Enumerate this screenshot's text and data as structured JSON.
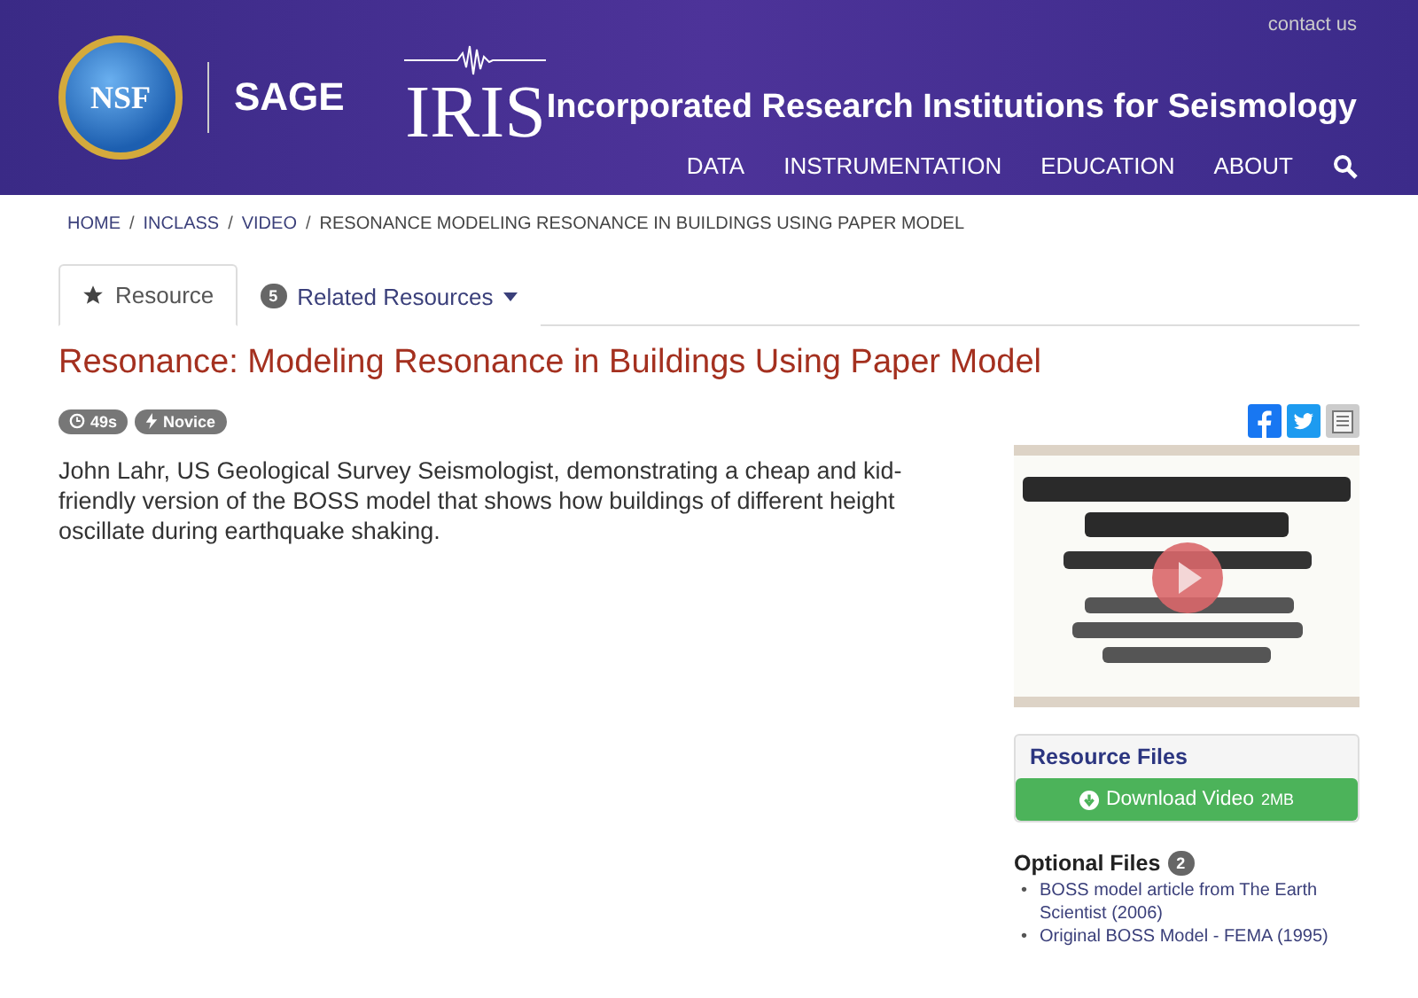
{
  "header": {
    "contact": "contact us",
    "logo_nsf": "NSF",
    "logo_sage": "SAGE",
    "logo_iris": "IRIS",
    "org_name": "Incorporated Research Institutions for Seismology",
    "nav": [
      {
        "label": "DATA"
      },
      {
        "label": "INSTRUMENTATION"
      },
      {
        "label": "EDUCATION"
      },
      {
        "label": "ABOUT"
      }
    ]
  },
  "breadcrumb": [
    {
      "label": "HOME",
      "link": true
    },
    {
      "separator": "/",
      "label": "INCLASS",
      "link": true
    },
    {
      "separator": "/",
      "label": "VIDEO",
      "link": true
    },
    {
      "separator": "/",
      "label": "RESONANCE MODELING RESONANCE IN BUILDINGS USING PAPER MODEL",
      "link": false
    }
  ],
  "tabs": [
    {
      "label": "Resource",
      "selected": true,
      "kind": "star"
    },
    {
      "label": "Related Resources",
      "count": "5",
      "selected": false,
      "kind": "dropdown"
    }
  ],
  "title": "Resonance: Modeling Resonance in Buildings Using Paper Model",
  "badges": [
    {
      "kind": "clock",
      "label": "49s"
    },
    {
      "kind": "bolt",
      "label": "Novice"
    }
  ],
  "description": "John Lahr, US Geological Survey Seismologist, demonstrating a cheap and kid-friendly version of the BOSS model that shows how buildings of different height oscillate during earthquake shaking.",
  "resource_files": {
    "heading": "Resource Files",
    "download": "Download Video",
    "size": "2MB"
  },
  "optional_files": {
    "heading": "Optional Files",
    "count": "2",
    "items": [
      {
        "bullet": "•",
        "text": "BOSS model article from The Earth Scientist (2006)"
      },
      {
        "bullet": "•",
        "text": "Original BOSS Model - FEMA (1995)"
      }
    ]
  }
}
